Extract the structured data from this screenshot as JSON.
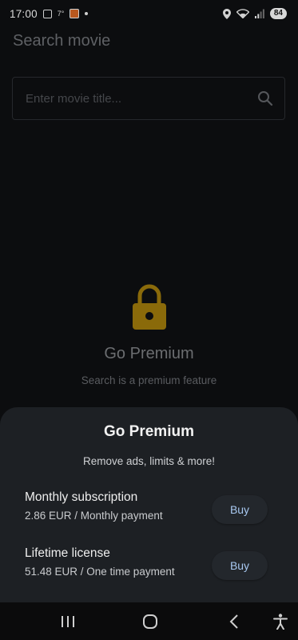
{
  "status_bar": {
    "time": "17:00",
    "small_text": "7°",
    "battery": "84"
  },
  "header": {
    "title": "Search movie"
  },
  "search": {
    "placeholder": "Enter movie title..."
  },
  "lock_screen": {
    "title": "Go Premium",
    "subtitle": "Search is a premium feature",
    "lock_color": "#8a6a0a"
  },
  "sheet": {
    "title": "Go Premium",
    "subtitle": "Remove ads, limits & more!",
    "options": [
      {
        "name": "Monthly subscription",
        "price": "2.86 EUR / Monthly payment",
        "button": "Buy"
      },
      {
        "name": "Lifetime license",
        "price": "51.48 EUR / One time payment",
        "button": "Buy"
      }
    ],
    "accent": "#a8c8f0"
  },
  "nav": {
    "icons": [
      "recent-apps-icon",
      "home-icon",
      "back-icon",
      "accessibility-icon"
    ]
  }
}
